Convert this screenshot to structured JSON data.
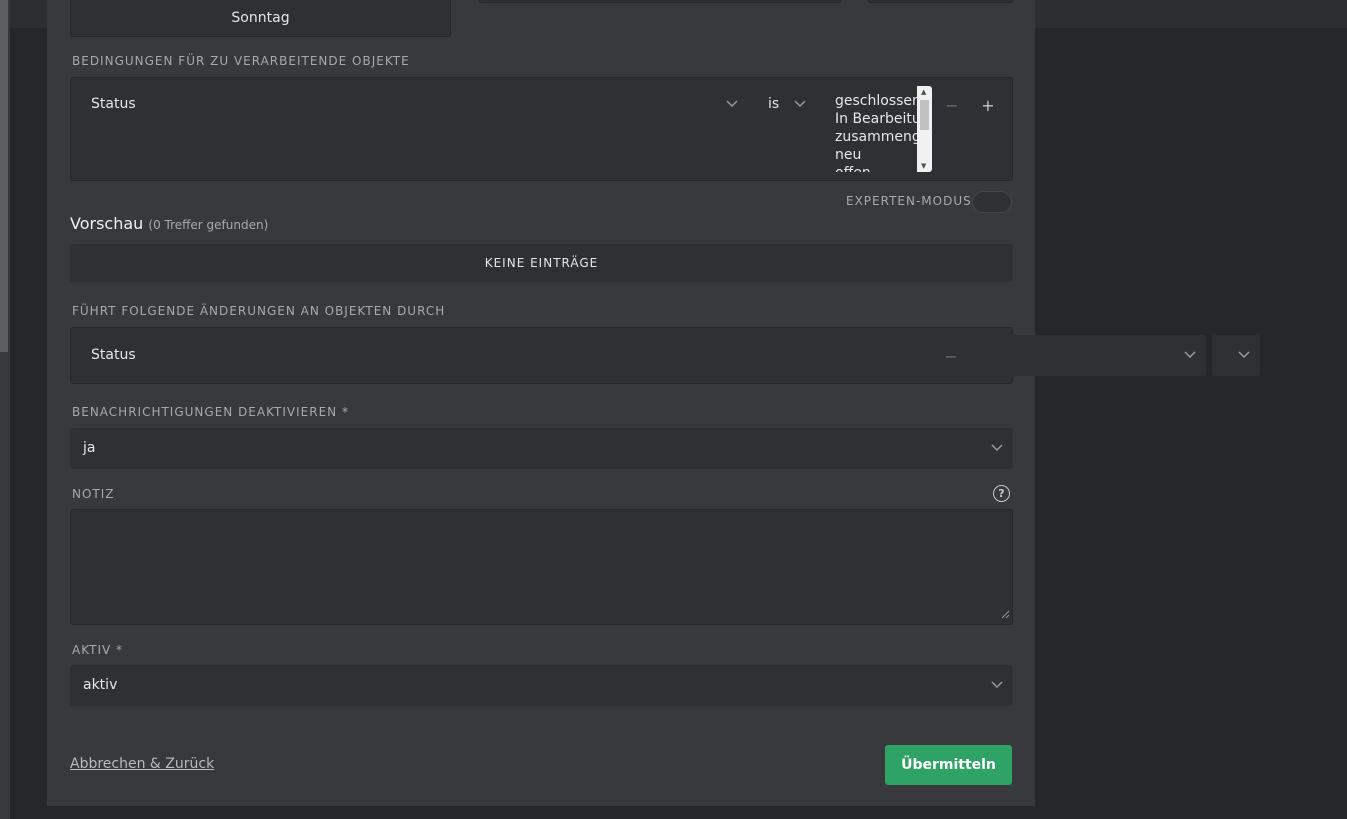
{
  "schedule": {
    "day_button": "Sonntag"
  },
  "conditions": {
    "label": "BEDINGUNGEN FÜR ZU VERARBEITENDE OBJEKTE",
    "attribute": "Status",
    "operator": "is",
    "values": [
      "geschlossen",
      "In Bearbeitung",
      "zusammengeführt",
      "neu",
      "offen"
    ],
    "expert_mode_label": "EXPERTEN-MODUS"
  },
  "preview": {
    "title": "Vorschau",
    "count": "(0 Treffer gefunden)",
    "empty": "KEINE EINTRÄGE"
  },
  "actions": {
    "label": "FÜHRT FOLGENDE ÄNDERUNGEN AN OBJEKTEN DURCH",
    "attribute": "Status"
  },
  "notifications": {
    "label": "BENACHRICHTIGUNGEN DEAKTIVIEREN *",
    "value": "ja"
  },
  "note": {
    "label": "NOTIZ",
    "value": ""
  },
  "active": {
    "label": "AKTIV *",
    "value": "aktiv"
  },
  "footer": {
    "cancel": "Abbrechen & Zurück",
    "submit": "Übermitteln"
  },
  "colors": {
    "submit": "#2fa365",
    "modal_bg": "#38393d",
    "field_bg": "#2f3034"
  }
}
